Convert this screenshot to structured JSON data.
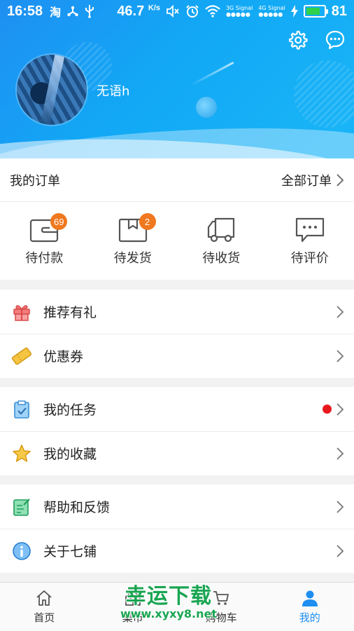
{
  "status_bar": {
    "time": "16:58",
    "speed_value": "46.7",
    "speed_unit": "K/s",
    "signal_3g": "3G Signal",
    "signal_4g": "4G Signal",
    "battery_level": "81",
    "battery_color": "#2fd14a",
    "icons": [
      "taobao-icon",
      "share-icon",
      "usb-icon",
      "mute-icon",
      "alarm-icon",
      "wifi-icon",
      "charging-icon"
    ]
  },
  "header": {
    "username": "无语h",
    "background_color": "#1e8ff2",
    "actions": [
      "settings-icon",
      "message-icon"
    ]
  },
  "orders": {
    "title": "我的订单",
    "all_label": "全部订单",
    "items": [
      {
        "label": "待付款",
        "badge": "69",
        "icon": "wallet-icon"
      },
      {
        "label": "待发货",
        "badge": "2",
        "icon": "box-icon"
      },
      {
        "label": "待收货",
        "badge": "",
        "icon": "truck-icon"
      },
      {
        "label": "待评价",
        "badge": "",
        "icon": "comment-icon"
      }
    ],
    "badge_color": "#f0781e"
  },
  "menu": {
    "referral": "推荐有礼",
    "coupons": "优惠券",
    "tasks": "我的任务",
    "favorites": "我的收藏",
    "help": "帮助和反馈",
    "about": "关于七铺"
  },
  "tabbar": {
    "tabs": [
      {
        "label": "首页",
        "icon": "home-icon",
        "active": false
      },
      {
        "label": "集市",
        "icon": "market-icon",
        "active": false
      },
      {
        "label": "购物车",
        "icon": "cart-icon",
        "active": false
      },
      {
        "label": "我的",
        "icon": "user-icon",
        "active": true
      }
    ],
    "active_color": "#1e8ef0"
  },
  "watermark": {
    "title": "幸运下载",
    "url": "www.xyxy8.net"
  }
}
